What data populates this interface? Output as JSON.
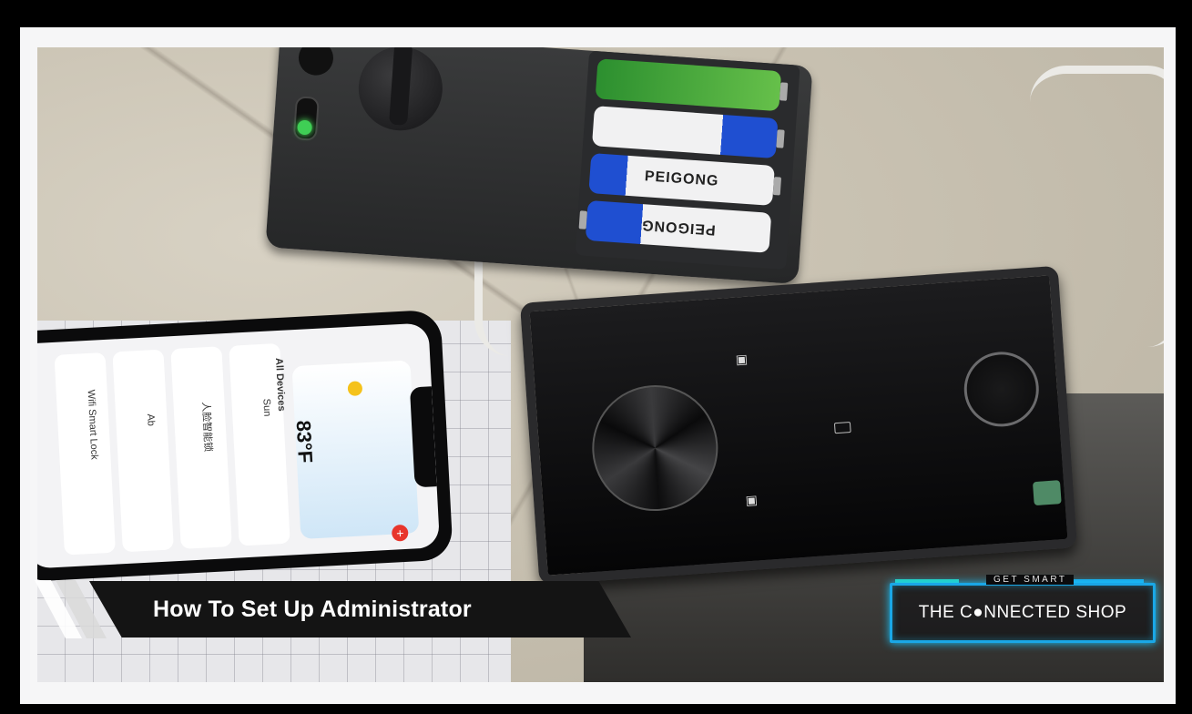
{
  "overlay": {
    "title": "How To Set Up Administrator",
    "logo_tagline": "GET SMART",
    "logo_name": "THE C●NNECTED SHOP"
  },
  "batteries": [
    {
      "label": "",
      "color": "#3aa53d"
    },
    {
      "label": "",
      "color": "#e9e9ea"
    },
    {
      "label": "PEIGONG",
      "color": "#e9e9ea"
    },
    {
      "label": "PEIGONG",
      "color": "#e9e9ea"
    }
  ],
  "phone_app": {
    "temperature": "83°F",
    "section_label": "All Devices",
    "devices": [
      "Sun",
      "人脸智能锁",
      "Ab",
      "Wifi Smart Lock"
    ]
  },
  "colors": {
    "logo_border": "#1aa7e6",
    "logo_accent": "#27d4b6",
    "lower_third_bg": "#141414",
    "led": "#3fcf55"
  }
}
